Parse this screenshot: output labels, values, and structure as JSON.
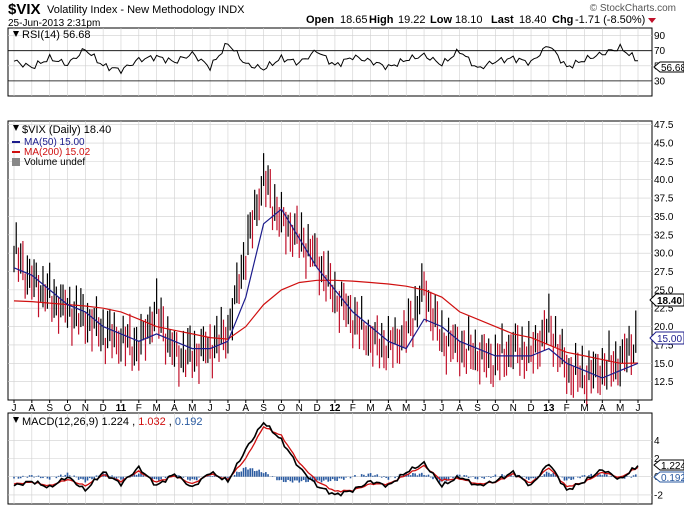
{
  "header": {
    "symbol": "$VIX",
    "description": "Volatility Index - New Methodology INDX",
    "date": "25-Jun-2013 2:31pm",
    "brand": "© StockCharts.com",
    "open_label": "Open",
    "open": "18.65",
    "high_label": "High",
    "high": "19.22",
    "low_label": "Low",
    "low": "18.10",
    "last_label": "Last",
    "last": "18.40",
    "chg_label": "Chg",
    "chg": "-1.71 (-8.50%)"
  },
  "rsi_panel": {
    "label": "RSI(14) 56.68",
    "value_tag": "56.68",
    "ticks": [
      "90",
      "70",
      "50",
      "30"
    ]
  },
  "price_panel": {
    "label": "$VIX (Daily) 18.40",
    "legend": [
      {
        "text": "MA(50) 15.00",
        "color": "#1c1c8c"
      },
      {
        "text": "MA(200) 15.02",
        "color": "#d01010"
      },
      {
        "text": "Volume undef",
        "color": "#000000"
      }
    ],
    "price_tag": "18.40",
    "ma_tag": "15.00",
    "ticks": [
      "47.5",
      "45.0",
      "42.5",
      "40.0",
      "37.5",
      "35.0",
      "32.5",
      "30.0",
      "27.5",
      "25.0",
      "22.5",
      "20.0",
      "17.5",
      "15.0",
      "12.5"
    ]
  },
  "x_axis": {
    "labels": [
      "J",
      "A",
      "S",
      "O",
      "N",
      "D",
      "11",
      "F",
      "M",
      "A",
      "M",
      "J",
      "J",
      "A",
      "S",
      "O",
      "N",
      "D",
      "12",
      "F",
      "M",
      "A",
      "M",
      "J",
      "J",
      "A",
      "S",
      "O",
      "N",
      "D",
      "13",
      "F",
      "M",
      "A",
      "M",
      "J"
    ],
    "year_labels": [
      "11",
      "12",
      "13"
    ]
  },
  "macd_panel": {
    "label_prefix": "MACD(12,26,9)",
    "macd": "1.224",
    "signal": "1.032",
    "hist": "0.192",
    "macd_tag": "1.224",
    "hist_tag": "0.192",
    "ticks": [
      "4",
      "2",
      "0",
      "-2"
    ]
  },
  "colors": {
    "grid": "#cfcfcf",
    "price": "#000000",
    "down_bar": "#c0102a",
    "ma50": "#1c1c8c",
    "ma200": "#d01010",
    "macd_hist": "#2a5aa0",
    "signal": "#d01010"
  },
  "chart_data": [
    {
      "type": "line",
      "title": "RSI(14) 56.68",
      "ylim": [
        10,
        100
      ],
      "series": [
        {
          "name": "RSI(14)",
          "values": [
            56,
            48,
            60,
            52,
            72,
            50,
            44,
            58,
            62,
            55,
            66,
            48,
            80,
            52,
            46,
            60,
            54,
            70,
            50,
            62,
            56,
            48,
            58,
            64,
            52,
            70,
            46,
            56,
            60,
            54,
            78,
            48,
            58,
            66,
            74,
            56.68
          ]
        }
      ],
      "reference_lines": [
        70,
        30
      ]
    },
    {
      "type": "line",
      "title": "$VIX (Daily) 18.40",
      "x": [
        "J",
        "A",
        "S",
        "O",
        "N",
        "D",
        "11",
        "F",
        "M",
        "A",
        "M",
        "J",
        "J",
        "A",
        "S",
        "O",
        "N",
        "D",
        "12",
        "F",
        "M",
        "A",
        "M",
        "J",
        "J",
        "A",
        "S",
        "O",
        "N",
        "D",
        "13",
        "F",
        "M",
        "A",
        "M",
        "J"
      ],
      "ylim": [
        10,
        48
      ],
      "series": [
        {
          "name": "$VIX",
          "values": [
            30,
            26,
            24,
            22,
            21,
            19,
            18,
            17,
            22,
            16,
            16,
            17,
            19,
            30,
            40,
            34,
            32,
            29,
            24,
            21,
            18,
            17,
            19,
            25,
            18,
            17,
            16,
            15,
            17,
            16,
            20,
            14,
            13,
            14,
            15,
            18.4
          ]
        },
        {
          "name": "MA(50)",
          "values": [
            28,
            27,
            25,
            23,
            22,
            20,
            19,
            18,
            19,
            18,
            17,
            17,
            18,
            24,
            34,
            36,
            32,
            28,
            25,
            22,
            20,
            18,
            17,
            21,
            20,
            18,
            17,
            16,
            16,
            16,
            17,
            15,
            14,
            13,
            14,
            15
          ]
        },
        {
          "name": "MA(200)",
          "values": [
            23.5,
            23.4,
            23.2,
            23,
            22.8,
            22.5,
            22,
            21,
            20,
            19.5,
            19,
            18.5,
            18.3,
            20,
            23,
            25,
            26,
            26.3,
            26.3,
            26.2,
            26,
            25.8,
            25.5,
            25,
            24,
            22,
            21,
            20,
            19,
            18.5,
            17.5,
            16.5,
            16,
            15.5,
            15,
            15.02
          ]
        }
      ]
    },
    {
      "type": "line",
      "title": "MACD(12,26,9) 1.224, 1.032, 0.192",
      "ylim": [
        -3,
        7
      ],
      "series": [
        {
          "name": "MACD(12,26,9)",
          "values": [
            -1,
            -0.5,
            -1.2,
            0,
            -1.5,
            0.5,
            -0.8,
            1,
            -1,
            0.3,
            -1.2,
            0.5,
            -0.5,
            3,
            6,
            4,
            1,
            -1,
            -2,
            -1.5,
            -0.5,
            -1,
            0.5,
            1.5,
            -1,
            0,
            -1,
            -0.5,
            0.5,
            -1,
            1.5,
            -1.5,
            -0.5,
            0.8,
            -0.3,
            1.224
          ]
        },
        {
          "name": "Signal",
          "values": [
            -0.8,
            -0.6,
            -1,
            -0.3,
            -1,
            0.2,
            -0.5,
            0.6,
            -0.6,
            0.1,
            -0.8,
            0.3,
            -0.3,
            2,
            5.5,
            4.5,
            1.5,
            -0.5,
            -1.6,
            -1.5,
            -0.8,
            -0.8,
            0.2,
            1.2,
            -0.4,
            -0.2,
            -0.8,
            -0.6,
            0.3,
            -0.7,
            1,
            -1.1,
            -0.6,
            0.5,
            -0.1,
            1.032
          ]
        },
        {
          "name": "Histogram",
          "values": [
            -0.2,
            0.1,
            -0.2,
            0.3,
            -0.5,
            0.3,
            -0.3,
            0.4,
            -0.4,
            0.2,
            -0.4,
            0.2,
            -0.2,
            1,
            0.5,
            -0.5,
            -0.5,
            -0.5,
            -0.4,
            0,
            0.3,
            -0.2,
            0.3,
            0.3,
            -0.6,
            0.2,
            -0.2,
            0.1,
            0.2,
            -0.3,
            0.5,
            -0.4,
            0.1,
            0.3,
            -0.2,
            0.192
          ]
        }
      ]
    }
  ]
}
